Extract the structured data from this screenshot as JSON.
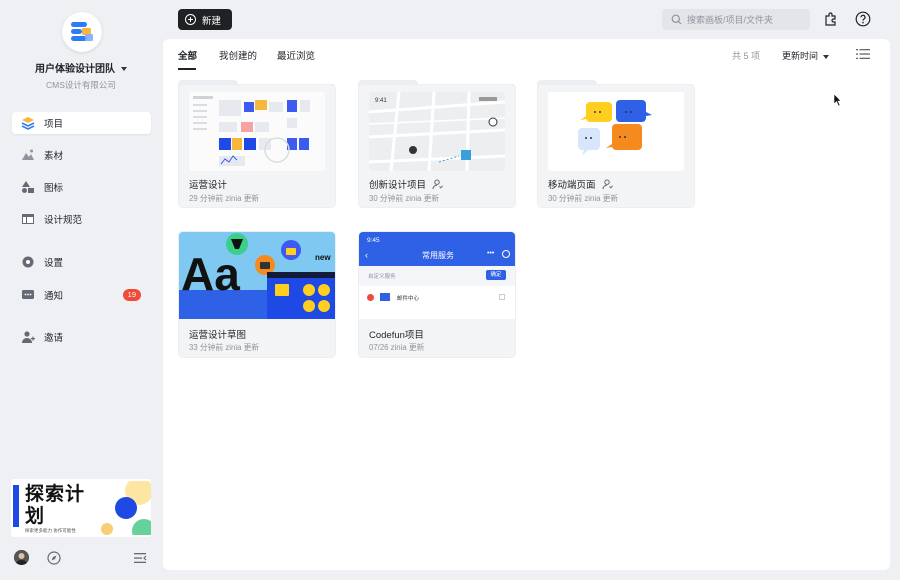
{
  "team": {
    "name": "用户体验设计团队",
    "company": "CMS设计有限公司"
  },
  "sidebar": {
    "items": [
      {
        "label": "项目",
        "icon": "layers-icon"
      },
      {
        "label": "素材",
        "icon": "mountain-image-icon"
      },
      {
        "label": "图标",
        "icon": "shapes-icon"
      },
      {
        "label": "设计规范",
        "icon": "table-icon"
      },
      {
        "label": "设置",
        "icon": "gear-icon"
      },
      {
        "label": "通知",
        "icon": "chat-bubble-icon",
        "badge": "19"
      },
      {
        "label": "邀请",
        "icon": "add-user-icon"
      }
    ],
    "active": "项目"
  },
  "promo": {
    "title": "探索计划",
    "subtitle": "探索更多能力 协作可能性"
  },
  "topbar": {
    "new_label": "新建",
    "search_placeholder": "搜索画板/项目/文件夹"
  },
  "main": {
    "tabs": [
      {
        "label": "全部"
      },
      {
        "label": "我创建的"
      },
      {
        "label": "最近浏览"
      }
    ],
    "active_tab": "全部",
    "count": "共 5 项",
    "sort_label": "更新时间"
  },
  "projects": [
    {
      "name": "运营设计",
      "meta": "29 分钟前 zinia 更新",
      "accent": "#f7a3a3",
      "shared": false
    },
    {
      "name": "创新设计项目",
      "meta": "30 分钟前 zinia 更新",
      "accent": "#8fd3f0",
      "shared": true
    },
    {
      "name": "移动端页面",
      "meta": "30 分钟前 zinia 更新",
      "accent": "#e3e5e8",
      "shared": true
    },
    {
      "name": "运营设计草图",
      "meta": "33 分钟前 zinia 更新",
      "shared": false
    },
    {
      "name": "Codefun项目",
      "meta": "07/26 zinia 更新",
      "shared": false
    }
  ],
  "mobile_preview": {
    "time": "9:45",
    "title": "常用服务",
    "section": "自定义服务",
    "confirm": "确定",
    "row": "邮件中心"
  },
  "colors": {
    "accent_blue": "#1f49e5",
    "badge_red": "#f04a3a",
    "dark": "#202124"
  }
}
